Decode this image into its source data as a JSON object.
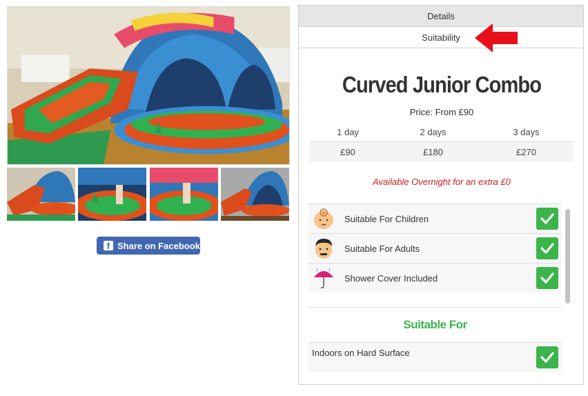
{
  "tabs": {
    "details": "Details",
    "suitability": "Suitability"
  },
  "product": {
    "title": "Curved Junior Combo",
    "price_line": "Price: From £90",
    "price_headers": [
      "1 day",
      "2 days",
      "3 days"
    ],
    "price_values": [
      "£90",
      "£180",
      "£270"
    ],
    "overnight": "Available Overnight for an extra £0"
  },
  "share": {
    "label": "Share on Facebook"
  },
  "features": [
    {
      "label": "Suitable For Children",
      "icon": "baby-icon"
    },
    {
      "label": "Suitable For Adults",
      "icon": "adult-face-icon"
    },
    {
      "label": "Shower Cover Included",
      "icon": "umbrella-icon"
    }
  ],
  "suitable_for": {
    "heading": "Suitable For",
    "items": [
      "Indoors on Hard Surface"
    ]
  },
  "colors": {
    "accent_green": "#3bb54a",
    "overnight_red": "#cc1d1d",
    "facebook_blue": "#4267b2",
    "arrow_red": "#e8101a"
  }
}
